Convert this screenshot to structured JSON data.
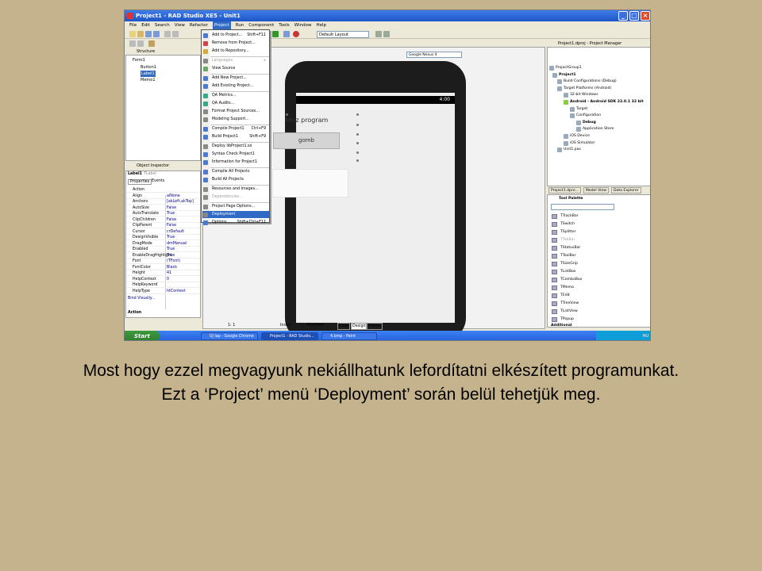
{
  "window": {
    "title": "Project1 - RAD Studio XE5 - Unit1"
  },
  "menubar": [
    "File",
    "Edit",
    "Search",
    "View",
    "Refactor",
    "Project",
    "Run",
    "Component",
    "Tools",
    "Window",
    "Help"
  ],
  "toolbar": {
    "layout_combo": "Default Layout"
  },
  "structure": {
    "title": "Structure",
    "items": [
      "Form1",
      "Button1",
      "Label1",
      "Memo1"
    ]
  },
  "object_inspector": {
    "title": "Object Inspector",
    "selected": "Label1",
    "selected_type": "TLabel",
    "tabs": [
      "Properties",
      "Events"
    ],
    "rows": [
      {
        "name": "Action",
        "value": ""
      },
      {
        "name": "Align",
        "value": "alNone"
      },
      {
        "name": "Anchors",
        "value": "[akLeft,akTop]"
      },
      {
        "name": "AutoSize",
        "value": "False"
      },
      {
        "name": "AutoTranslate",
        "value": "True"
      },
      {
        "name": "ClipChildren",
        "value": "False"
      },
      {
        "name": "ClipParent",
        "value": "False"
      },
      {
        "name": "Cursor",
        "value": "crDefault"
      },
      {
        "name": "DesignVisible",
        "value": "True"
      },
      {
        "name": "DragMode",
        "value": "dmManual"
      },
      {
        "name": "Enabled",
        "value": "True"
      },
      {
        "name": "EnableDragHighlight",
        "value": "True"
      },
      {
        "name": "Font",
        "value": "(TFont)"
      },
      {
        "name": "FontColor",
        "value": "Black"
      },
      {
        "name": "Height",
        "value": "41"
      },
      {
        "name": "HelpContext",
        "value": "0"
      },
      {
        "name": "HelpKeyword",
        "value": ""
      },
      {
        "name": "HelpType",
        "value": "htContext"
      }
    ],
    "footer_link": "Bind Visually...",
    "footer_label": "Action"
  },
  "project_menu": {
    "items": [
      {
        "label": "Add to Project...",
        "shortcut": "Shift+F11",
        "disabled": false
      },
      {
        "label": "Remove from Project...",
        "shortcut": "",
        "disabled": false
      },
      {
        "label": "Add to Repository...",
        "shortcut": "",
        "disabled": false
      },
      {
        "label": "Languages",
        "shortcut": "▸",
        "disabled": true
      },
      {
        "label": "View Source",
        "shortcut": "",
        "disabled": false
      },
      {
        "label": "Add New Project...",
        "shortcut": "",
        "disabled": false
      },
      {
        "label": "Add Existing Project...",
        "shortcut": "",
        "disabled": false
      },
      {
        "label": "QA Metrics...",
        "shortcut": "",
        "disabled": false
      },
      {
        "label": "QA Audits...",
        "shortcut": "",
        "disabled": false
      },
      {
        "label": "Format Project Sources...",
        "shortcut": "",
        "disabled": false
      },
      {
        "label": "Modeling Support...",
        "shortcut": "",
        "disabled": false
      },
      {
        "label": "Compile Project1",
        "shortcut": "Ctrl+F9",
        "disabled": false
      },
      {
        "label": "Build Project1",
        "shortcut": "Shift+F9",
        "disabled": false
      },
      {
        "label": "Deploy libProject1.so",
        "shortcut": "",
        "disabled": false
      },
      {
        "label": "Syntax Check Project1",
        "shortcut": "",
        "disabled": false
      },
      {
        "label": "Information for Project1",
        "shortcut": "",
        "disabled": false
      },
      {
        "label": "Compile All Projects",
        "shortcut": "",
        "disabled": false
      },
      {
        "label": "Build All Projects",
        "shortcut": "",
        "disabled": false
      },
      {
        "label": "Resources and Images...",
        "shortcut": "",
        "disabled": false
      },
      {
        "label": "Dependencies...",
        "shortcut": "",
        "disabled": true
      },
      {
        "label": "Project Page Options...",
        "shortcut": "",
        "disabled": false
      },
      {
        "label": "Deployment",
        "shortcut": "",
        "disabled": false
      },
      {
        "label": "Options...",
        "shortcut": "Shift+Ctrl+F11",
        "disabled": false
      }
    ],
    "highlighted": "Deployment"
  },
  "designer": {
    "device_combo": "Google Nexus 4",
    "status_time": "4:00",
    "label_text": "kész program",
    "button_text": "gomb"
  },
  "project_manager": {
    "title": "Project1.dproj - Project Manager",
    "items": [
      "ProjectGroup1",
      "Project1",
      "Build Configurations (Debug)",
      "Target Platforms (Android)",
      "32-bit Windows",
      "Android - Android SDK 22.0.1 32 bit",
      "Target",
      "Configuration",
      "Debug",
      "Application Store",
      "iOS Device",
      "iOS Simulator",
      "Unit1.pas"
    ],
    "tabs": [
      "Project1.dpro...",
      "Model View",
      "Data Explorer"
    ]
  },
  "tool_palette": {
    "title": "Tool Palette",
    "items": [
      "TTrackBar",
      "TSwitch",
      "TSplitter",
      "TTabBar",
      "TStatusBar",
      "TToolBar",
      "TSizeGrip",
      "TListBox",
      "TComboBox",
      "TMemo",
      "TEdit",
      "TTreeView",
      "TListView",
      "TPopup"
    ],
    "group": "Additional"
  },
  "statusline": {
    "pos": "1: 1",
    "mode": "Insert",
    "state": "Modified",
    "tabs": [
      "Code",
      "Design",
      "History"
    ]
  },
  "taskbar": {
    "start": "Start",
    "tasks": [
      "Új lap - Google Chrome",
      "Project1 - RAD Studio...",
      "4.bmp - Paint"
    ],
    "tray": "HU"
  },
  "caption": {
    "line1": "Most hogy ezzel megvagyunk nekiállhatunk lefordítatni elkészített programunkat.",
    "line2": "Ezt a ‘Project’ menü ‘Deployment’ során belül tehetjük meg."
  }
}
